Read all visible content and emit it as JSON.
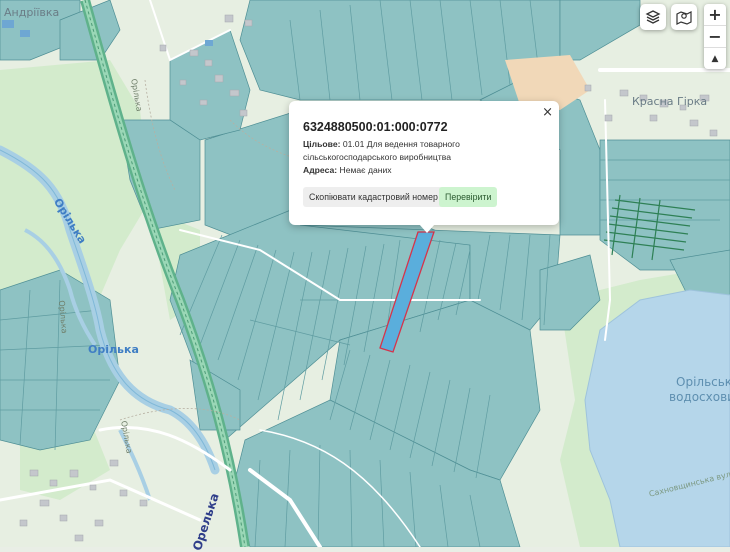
{
  "map": {
    "places": {
      "andriivka": "Андріївка",
      "krasna_hirka": "Красна Гірка"
    },
    "reservoir": {
      "line1": "Орільське",
      "line2": "водосховище"
    },
    "rivers": {
      "orilka_main": "Орілька",
      "orilka_north": "Орілька",
      "orilka_small": "Орілька",
      "orilka_vertical": "Орілька",
      "orilka_south": "Орілька"
    },
    "road_label": "Орелька",
    "street_label": "Сахновщинська вулиця"
  },
  "controls": {
    "layers_icon": "layers-icon",
    "map_icon": "map-marker-icon",
    "zoom_in": "+",
    "zoom_out": "−",
    "compass": "▲"
  },
  "popup": {
    "close": "×",
    "cadastral_number": "6324880500:01:000:0772",
    "purpose_label": "Цільове:",
    "purpose_value": "01.01 Для ведення товарного сільськогосподарського виробництва",
    "address_label": "Адреса:",
    "address_value": "Немає даних",
    "copy_button": "Скопіювати кадастровий номер",
    "check_button": "Перевірити"
  },
  "colors": {
    "parcel_fill": "#8ec2c3",
    "parcel_stroke": "#4f8f95",
    "selected_parcel": "#5aaedc",
    "selected_outline": "#d6334a",
    "water": "#b5d6ea",
    "meadow": "#d6ecd0",
    "railway": "#5fb28b",
    "sand": "#f1d8b8"
  }
}
